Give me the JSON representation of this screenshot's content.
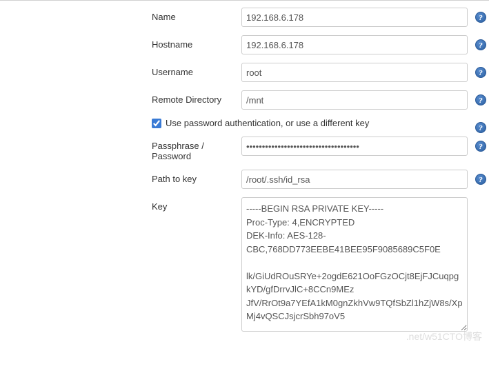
{
  "fields": {
    "name": {
      "label": "Name",
      "value": "192.168.6.178"
    },
    "hostname": {
      "label": "Hostname",
      "value": "192.168.6.178"
    },
    "username": {
      "label": "Username",
      "value": "root"
    },
    "remote_directory": {
      "label": "Remote Directory",
      "value": "/mnt"
    },
    "use_password_auth": {
      "label": "Use password authentication, or use a different key",
      "checked": true
    },
    "passphrase": {
      "label": "Passphrase / Password",
      "value": "••••••••••••••••••••••••••••••••••••"
    },
    "path_to_key": {
      "label": "Path to key",
      "value": "/root/.ssh/id_rsa"
    },
    "key": {
      "label": "Key",
      "value": "-----BEGIN RSA PRIVATE KEY-----\nProc-Type: 4,ENCRYPTED\nDEK-Info: AES-128-CBC,768DD773EEBE41BEE95F9085689C5F0E\n\nlk/GiUdROuSRYe+2ogdE621OoFGzOCjt8EjFJCuqpgkYD/gfDrrvJlC+8CCn9MEz\nJfV/RrOt9a7YEfA1kM0gnZkhVw9TQfSbZl1hZjW8s/XpMj4vQSCJsjcrSbh97oV5"
    }
  },
  "help_glyph": "?",
  "watermark": ".net/w51CTO博客"
}
